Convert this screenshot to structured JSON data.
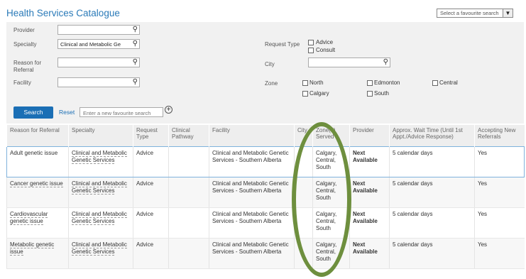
{
  "page": {
    "title": "Health Services Catalogue"
  },
  "favourite_search": {
    "placeholder": "Select a favourite search"
  },
  "filters": {
    "provider": {
      "label": "Provider",
      "value": ""
    },
    "specialty": {
      "label": "Specialty",
      "value": "Clinical and Metabolic Ge"
    },
    "reason": {
      "label": "Reason for Referral",
      "value": ""
    },
    "facility": {
      "label": "Facility",
      "value": ""
    },
    "request_type": {
      "label": "Request Type",
      "options": [
        "Advice",
        "Consult"
      ]
    },
    "city": {
      "label": "City",
      "value": ""
    },
    "zone": {
      "label": "Zone",
      "options": [
        "North",
        "Edmonton",
        "Central",
        "Calgary",
        "South"
      ]
    }
  },
  "actions": {
    "search": "Search",
    "reset": "Reset",
    "fav_placeholder": "Enter a new favourite search",
    "add": "+"
  },
  "table": {
    "headers": [
      "Reason for Referral",
      "Specialty",
      "Request Type",
      "Clinical Pathway",
      "Facility",
      "City",
      "Zone(s) Served",
      "Provider",
      "Approx. Wait Time (Until 1st Appt./Advice Response)",
      "Accepting New Referrals"
    ],
    "rows": [
      {
        "reason": "Adult genetic issue",
        "specialty": "Clinical and Metabolic Genetic Services",
        "request": "Advice",
        "pathway": "",
        "facility": "Clinical and Metabolic Genetic Services - Southern Alberta",
        "city": "",
        "zones": "Calgary, Central, South",
        "provider": "Next Available",
        "wait": "5 calendar days",
        "accepting": "Yes"
      },
      {
        "reason": "Cancer genetic issue",
        "specialty": "Clinical and Metabolic Genetic Services",
        "request": "Advice",
        "pathway": "",
        "facility": "Clinical and Metabolic Genetic Services - Southern Alberta",
        "city": "",
        "zones": "Calgary, Central, South",
        "provider": "Next Available",
        "wait": "5 calendar days",
        "accepting": "Yes"
      },
      {
        "reason": "Cardiovascular genetic issue",
        "specialty": "Clinical and Metabolic Genetic Services",
        "request": "Advice",
        "pathway": "",
        "facility": "Clinical and Metabolic Genetic Services - Southern Alberta",
        "city": "",
        "zones": "Calgary, Central, South",
        "provider": "Next Available",
        "wait": "5 calendar days",
        "accepting": "Yes"
      },
      {
        "reason": "Metabolic genetic issue",
        "specialty": "Clinical and Metabolic Genetic Services",
        "request": "Advice",
        "pathway": "",
        "facility": "Clinical and Metabolic Genetic Services - Southern Alberta",
        "city": "",
        "zones": "Calgary, Central, South",
        "provider": "Next Available",
        "wait": "5 calendar days",
        "accepting": "Yes"
      }
    ]
  },
  "colors": {
    "title": "#2a7ab8",
    "button": "#1b6fb5",
    "annotation": "#6e8f3e"
  }
}
